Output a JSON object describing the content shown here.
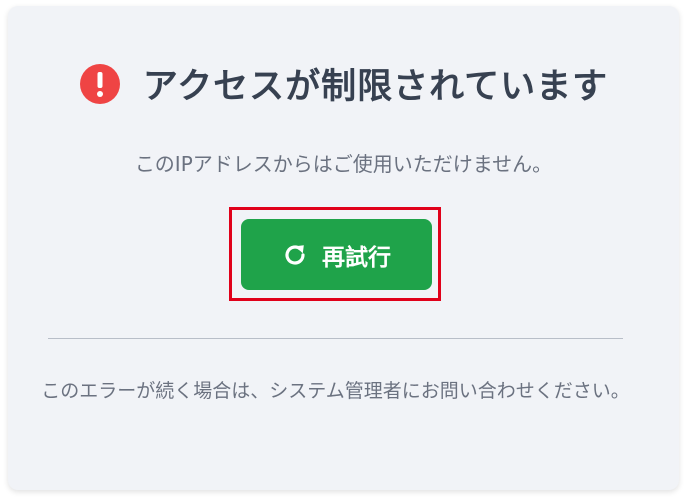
{
  "error": {
    "title": "アクセスが制限されています",
    "message": "このIPアドレスからはご使用いただけません。",
    "icon": "alert-circle-icon"
  },
  "actions": {
    "retry_label": "再試行",
    "retry_icon": "refresh-icon"
  },
  "footer": {
    "note": "このエラーが続く場合は、システム管理者にお問い合わせください。"
  },
  "colors": {
    "alert": "#ef4444",
    "button": "#1fa34a",
    "highlight": "#e0001a",
    "title": "#374151",
    "text": "#6b7280",
    "card": "#f1f3f7"
  }
}
